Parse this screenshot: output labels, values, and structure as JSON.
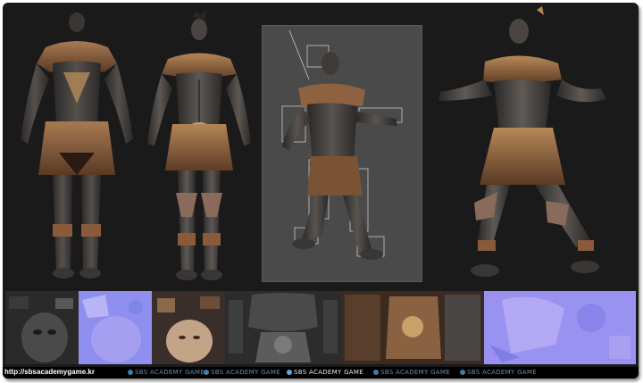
{
  "footer": {
    "url": "http://sbsacademygame.kr",
    "watermarks": [
      "SBS ACADEMY GAME",
      "SBS ACADEMY GAME",
      "SBS ACADEMY GAME",
      "SBS ACADEMY GAME",
      "SBS ACADEMY GAME"
    ]
  },
  "colors": {
    "background": "#1b1a1a",
    "viewport": "#4a4a4a",
    "skin": "#3b3836",
    "bronze": "#8a5a3a",
    "gold": "#c9a06a",
    "normal_map": "#8f8ff0"
  }
}
